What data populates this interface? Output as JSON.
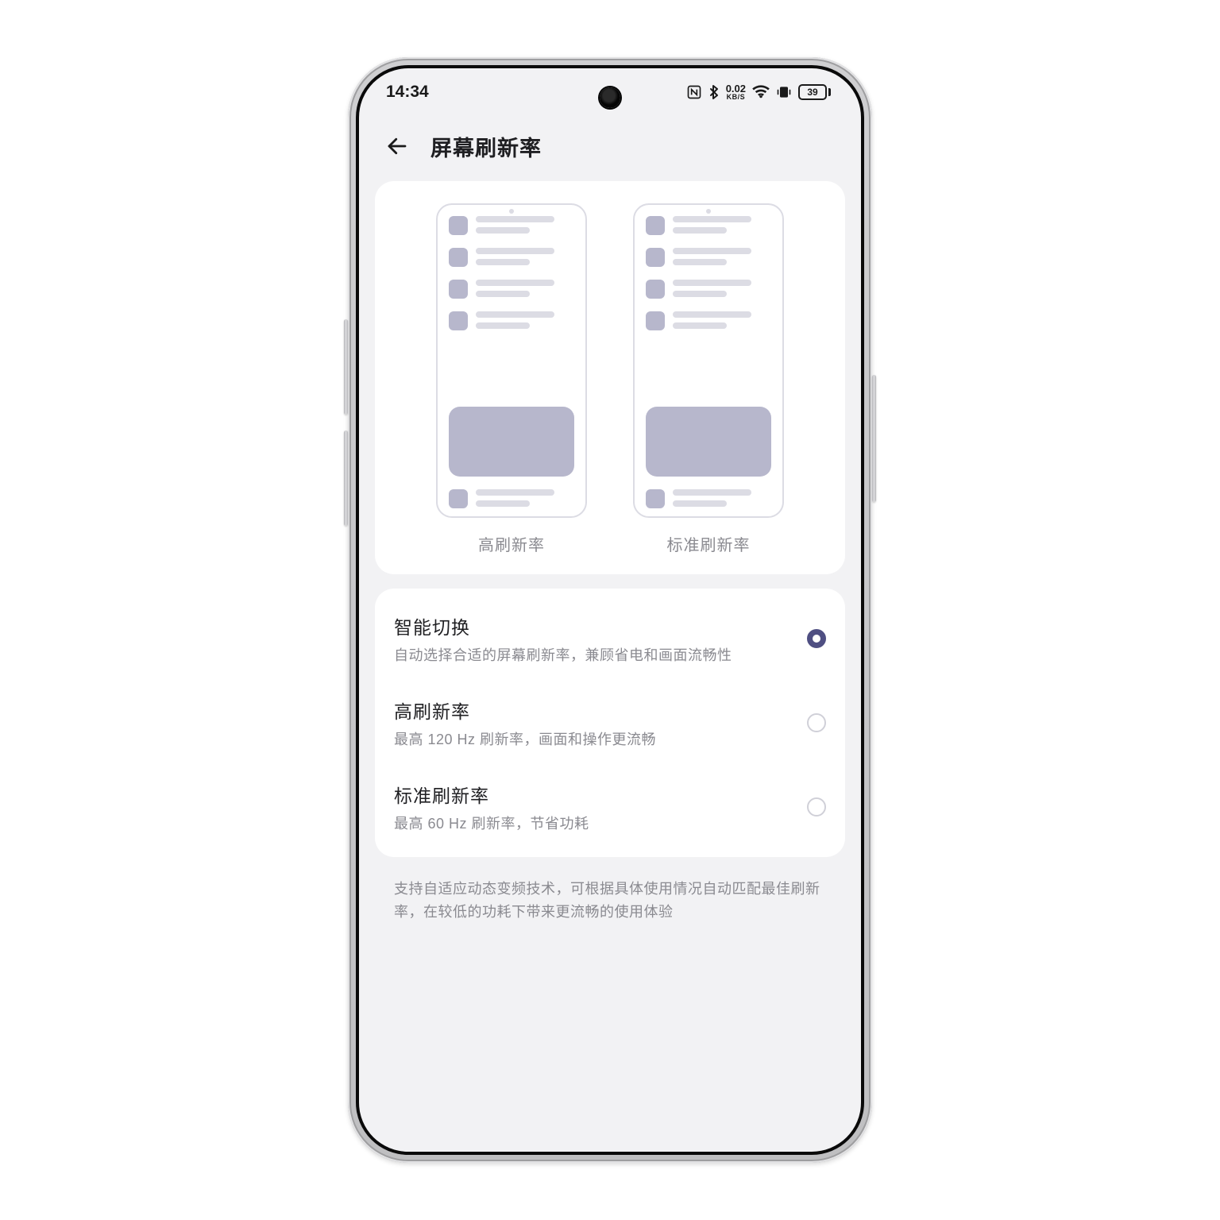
{
  "status": {
    "time": "14:34",
    "net_rate_value": "0.02",
    "net_rate_unit": "KB/S",
    "battery_pct": "39"
  },
  "header": {
    "title": "屏幕刷新率"
  },
  "preview": {
    "items": [
      {
        "label": "高刷新率"
      },
      {
        "label": "标准刷新率"
      }
    ]
  },
  "options": [
    {
      "id": "smart",
      "title": "智能切换",
      "subtitle": "自动选择合适的屏幕刷新率，兼顾省电和画面流畅性",
      "selected": true
    },
    {
      "id": "high",
      "title": "高刷新率",
      "subtitle": "最高 120 Hz 刷新率，画面和操作更流畅",
      "selected": false
    },
    {
      "id": "standard",
      "title": "标准刷新率",
      "subtitle": "最高 60 Hz 刷新率，节省功耗",
      "selected": false
    }
  ],
  "footer_note": "支持自适应动态变频技术，可根据具体使用情况自动匹配最佳刷新率，在较低的功耗下带来更流畅的使用体验"
}
